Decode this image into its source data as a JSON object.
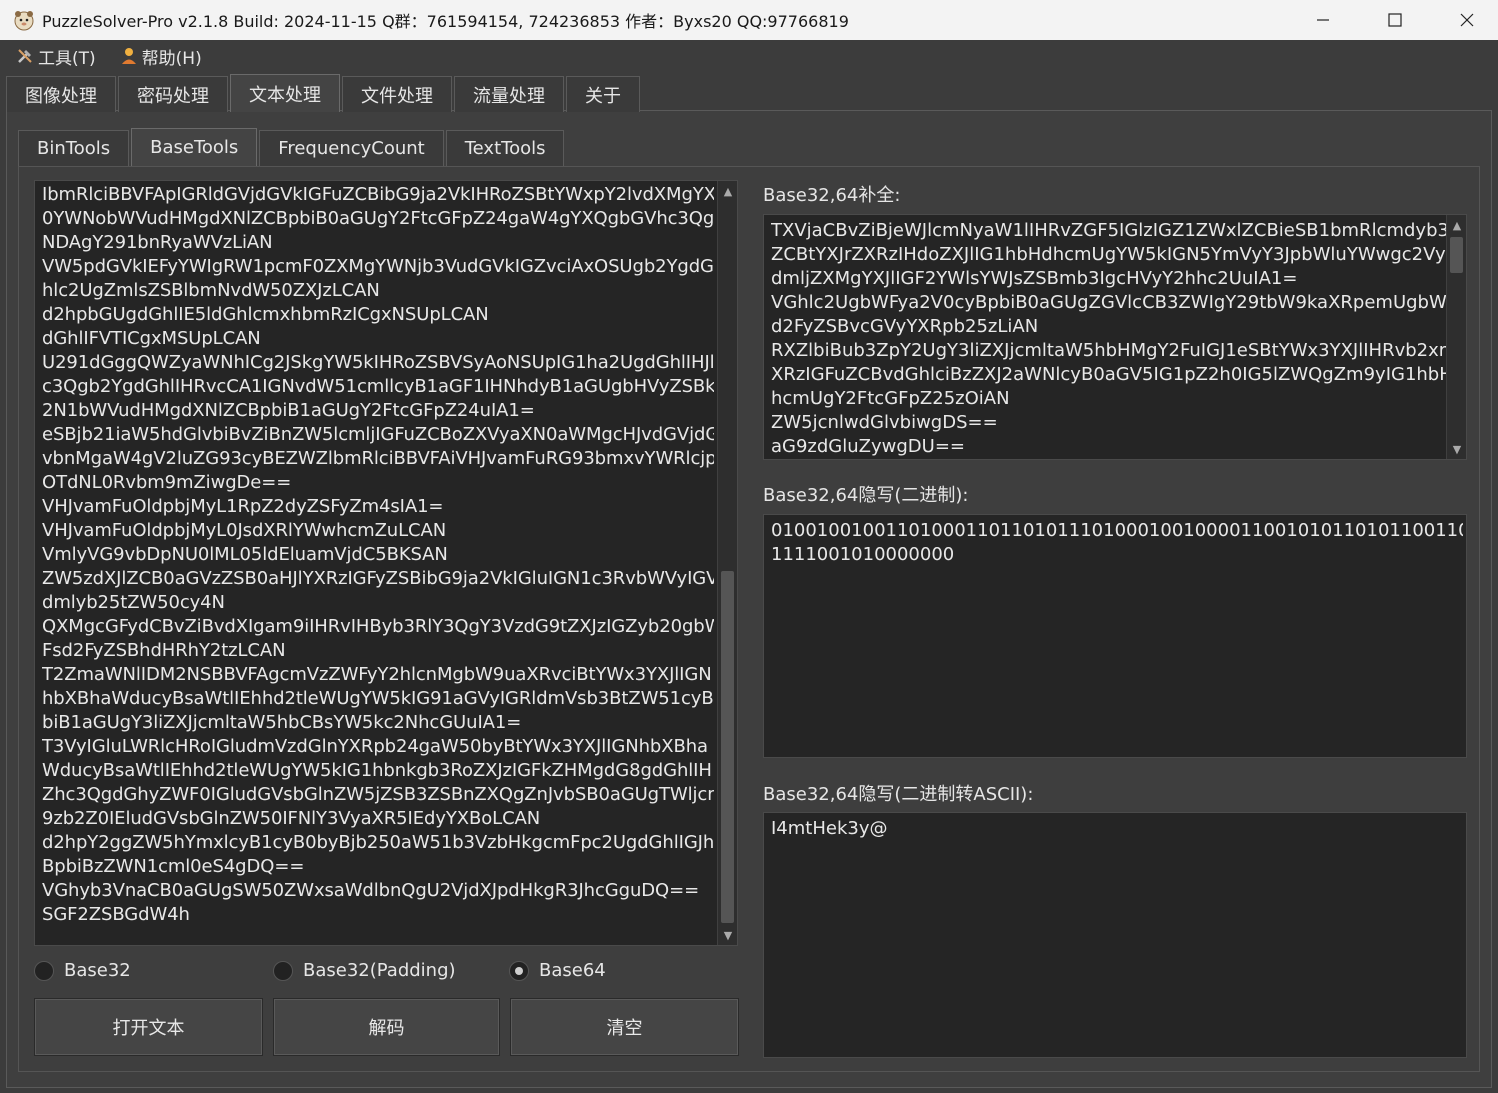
{
  "window": {
    "title": "PuzzleSolver-Pro v2.1.8  Build: 2024-11-15  Q群：761594154, 724236853  作者：Byxs20  QQ:97766819"
  },
  "menu": {
    "tools": "工具(T)",
    "help": "帮助(H)"
  },
  "main_tabs": [
    "图像处理",
    "密码处理",
    "文本处理",
    "文件处理",
    "流量处理",
    "关于"
  ],
  "sub_tabs": [
    "BinTools",
    "BaseTools",
    "FrequencyCount",
    "TextTools"
  ],
  "input_text": "IbmRlciBBVFApIGRldGVjdGVkIGFuZCBibG9ja2VkIHRoZSBtYWxpY2lvdXMgYXR\n0YWNobWVudHMgdXNlZCBpbiB0aGUgY2FtcGFpZ24gaW4gYXQgbGVhc3Qg\nNDAgY291bnRyaWVzLiAN\nVW5pdGVkIEFyYWIgRW1pcmF0ZXMgYWNjb3VudGVkIGZvciAxOSUgb2YgdG\nhlc2UgZmlsZSBlbmNvdW50ZXJzLCAN\nd2hpbGUgdGhlIE5ldGhlcmxhbmRzICgxNSUpLCAN\ndGhlIFVTICgxMSUpLCAN\nU291dGggQWZyaWNhICg2JSkgYW5kIHRoZSBVSyAoNSUpIG1ha2UgdGhlIHJl\nc3Qgb2YgdGhlIHRvcCA1IGNvdW51cmllcyB1aGF1IHNhdyB1aGUgbHVyZSBkb\n2N1bWVudHMgdXNlZCBpbiB1aGUgY2FtcGFpZ24uIA1=\neSBjb21iaW5hdGlvbiBvZiBnZW5lcmljIGFuZCBoZXVyaXN0aWMgcHJvdGVjdGl\nvbnMgaW4gV2luZG93cyBEZWZlbmRlciBBVFAiVHJvamFuRG93bmxvYWRlcjpP\nOTdNL0Rvbm9mZiwgDe==\nVHJvamFuOldpbjMyL1RpZ2dyZSFyZm4sIA1=\nVHJvamFuOldpbjMyL0JsdXRlYWwhcmZuLCAN\nVmlyVG9vbDpNU0lML05ldEluamVjdC5BKSAN\nZW5zdXJlZCB0aGVzZSB0aHJlYXRzIGFyZSBibG9ja2VkIGluIGN1c3RvbWVyIGVu\ndmlyb25tZW50cy4N\nQXMgcGFydCBvZiBvdXIgam9iIHRvIHByb3RlY3QgY3VzdG9tZXJzIGZyb20gbW\nFsd2FyZSBhdHRhY2tzLCAN\nT2ZmaWNlIDM2NSBBVFAgcmVzZWFyY2hlcnMgbW9uaXRvciBtYWx3YXJlIGN\nhbXBhaWducyBsaWtlIEhhd2tleWUgYW5kIG91aGVyIGRldmVsb3BtZW51cyBp\nbiB1aGUgY3liZXJjcmltaW5hbCBsYW5kc2NhcGUuIA1=\nT3VyIGluLWRlcHRoIGludmVzdGlnYXRpb24gaW50byBtYWx3YXJlIGNhbXBha\nWducyBsaWtlIEhhd2tleWUgYW5kIG1hbnkgb3RoZXJzIGFkZHMgdG8gdGhlIH\nZhc3QgdGhyZWF0IGludGVsbGlnZW5jZSB3ZSBnZXQgZnJvbSB0aGUgTWljcm\n9zb2Z0IEludGVsbGlnZW50IFNlY3VyaXR5IEdyYXBoLCAN\nd2hpY2ggZW5hYmxlcyB1cyB0byBjb250aW51b3VzbHkgcmFpc2UgdGhlIGJhci\nBpbiBzZWN1cml0eS4gDQ==\nVGhyb3VnaCB0aGUgSW50ZWxsaWdlbnQgU2VjdXJpdHkgR3JhcGguDQ==\nSGF2ZSBGdW4h",
  "radios": [
    {
      "label": "Base32",
      "checked": false
    },
    {
      "label": "Base32(Padding)",
      "checked": false
    },
    {
      "label": "Base64",
      "checked": true
    }
  ],
  "buttons": {
    "open": "打开文本",
    "decode": "解码",
    "clear": "清空"
  },
  "right": {
    "padding_label": "Base32,64补全:",
    "padding_text": "TXVjaCBvZiBjeWJlcmNyaW1lIHRvZGF5IGlzIGZ1ZWxlZCBieSB1bmRlcmdyb3Vu\nZCBtYXJrZXRzIHdoZXJlIG1hbHdhcmUgYW5kIGN5YmVyY3JpbWluYWwgc2Vy\ndmljZXMgYXJlIGF2YWlsYWJsZSBmb3IgcHVyY2hhc2UuIA1=\nVGhlc2UgbWFya2V0cyBpbiB0aGUgZGVlcCB3ZWIgY29tbW9kaXRpemUgbWFs\nd2FyZSBvcGVyYXRpb25zLiAN\nRXZlbiBub3ZpY2UgY3liZXJjcmltaW5hbHMgY2FuIGJ1eSBtYWx3YXJlIHRvb2xra\nXRzIGFuZCBvdGhlciBzZXJ2aWNlcyB0aGV5IG1pZ2h0IG5lZWQgZm9yIG1hbHd\nhcmUgY2FtcGFpZ25zOiAN\nZW5jcnlwdGlvbiwgDS==\naG9zdGluZywgDU==",
    "binary_label": "Base32,64隐写(二进制):",
    "binary_text": "0100100100110100011011010111010001001000011001010110101100110011 0\n1111001010000000",
    "ascii_label": "Base32,64隐写(二进制转ASCII):",
    "ascii_text": "I4mtHek3y@"
  }
}
